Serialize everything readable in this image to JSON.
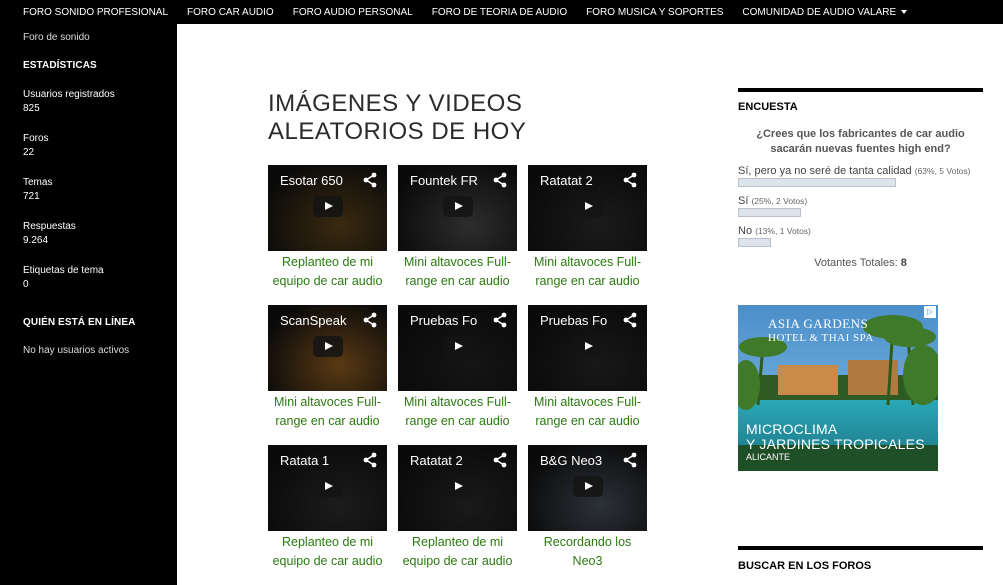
{
  "topnav": {
    "items": [
      {
        "label": "FORO SONIDO PROFESIONAL"
      },
      {
        "label": "FORO CAR AUDIO"
      },
      {
        "label": "FORO AUDIO PERSONAL"
      },
      {
        "label": "FORO DE TEORIA DE AUDIO"
      },
      {
        "label": "FORO MUSICA Y SOPORTES"
      },
      {
        "label": "COMUNIDAD DE AUDIO VALARE"
      }
    ]
  },
  "sidebar": {
    "forum_link": "Foro de sonido",
    "stats_title": "ESTADÍSTICAS",
    "stats": [
      {
        "label": "Usuarios registrados",
        "value": "825"
      },
      {
        "label": "Foros",
        "value": "22"
      },
      {
        "label": "Temas",
        "value": "721"
      },
      {
        "label": "Respuestas",
        "value": "9.264"
      },
      {
        "label": "Etiquetas de tema",
        "value": "0"
      }
    ],
    "online_title": "QUIÉN ESTÁ EN LÍNEA",
    "online_text": "No hay usuarios activos"
  },
  "main": {
    "title": "IMÁGENES Y VIDEOS ALEATORIOS DE HOY",
    "videos": [
      {
        "title": "Esotar 650",
        "caption": "Replanteo de mi equipo de car audio",
        "scene": "#3a2a10"
      },
      {
        "title": "Fountek FR",
        "caption": "Mini altavoces Full-range en car audio",
        "scene": "#2d2d2d"
      },
      {
        "title": "Ratatat 2",
        "caption": "Mini altavoces Full-range en car audio",
        "scene": "#1b1b1b"
      },
      {
        "title": "ScanSpeak",
        "caption": "Mini altavoces Full-range en car audio",
        "scene": "#5a3a14"
      },
      {
        "title": "Pruebas Fo",
        "caption": "Mini altavoces Full-range en car audio",
        "scene": "#151515"
      },
      {
        "title": "Pruebas Fo",
        "caption": "Mini altavoces Full-range en car audio",
        "scene": "#181818"
      },
      {
        "title": "Ratata 1",
        "caption": "Replanteo de mi equipo de car audio",
        "scene": "#1c1c1c"
      },
      {
        "title": "Ratatat 2",
        "caption": "Replanteo de mi equipo de car audio",
        "scene": "#1a1a1a"
      },
      {
        "title": "B&G Neo3",
        "caption": "Recordando los Neo3",
        "scene": "#2c3138"
      }
    ]
  },
  "poll": {
    "header": "ENCUESTA",
    "question": "¿Crees que los fabricantes de car audio sacarán nuevas fuentes high end?",
    "options": [
      {
        "label": "Sí, pero ya no seré de tanta calidad",
        "stats": "(63%, 5 Votos)",
        "fraction": 0.63
      },
      {
        "label": "Sí",
        "stats": "(25%, 2 Votos)",
        "fraction": 0.25
      },
      {
        "label": "No",
        "stats": "(13%, 1 Votos)",
        "fraction": 0.13
      }
    ],
    "total_label": "Votantes Totales:",
    "total_value": "8"
  },
  "ad": {
    "brand_line1": "ASIA GARDENS",
    "brand_line2": "HOTEL & THAI SPA",
    "slogan_line1": "MICROCLIMA",
    "slogan_line2": "Y JARDINES TROPICALES",
    "location": "ALICANTE"
  },
  "search": {
    "header": "BUSCAR EN LOS FOROS"
  }
}
